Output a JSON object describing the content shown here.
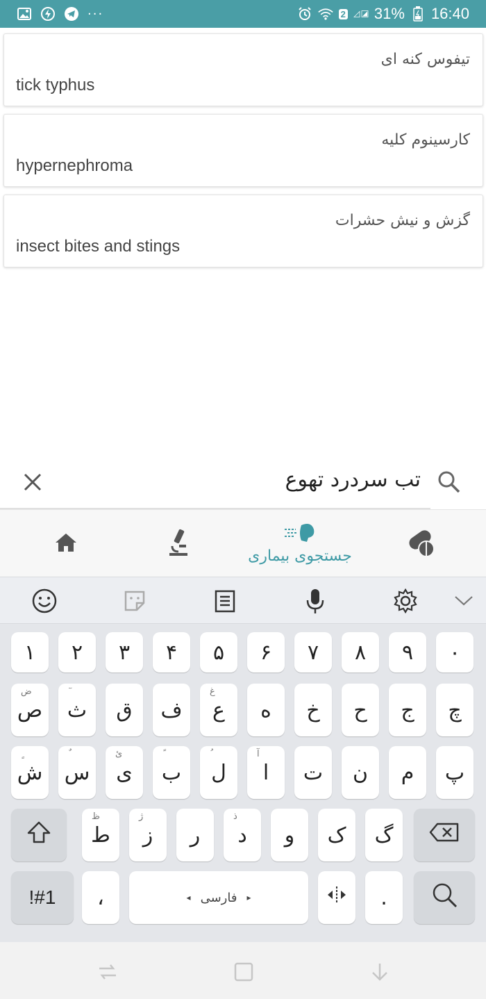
{
  "status_bar": {
    "sim_badge": "2",
    "battery_percent": "31%",
    "time": "16:40",
    "more_dots": "···",
    "icons": [
      "gallery-icon",
      "power-saving-icon",
      "telegram-icon",
      "alarm-icon",
      "wifi-icon",
      "signal-icon",
      "battery-icon"
    ]
  },
  "results": [
    {
      "persian": "تیفوس کنه ای",
      "english": "tick typhus"
    },
    {
      "persian": "کارسینوم کلیه",
      "english": "hypernephroma"
    },
    {
      "persian": "گزش و نیش حشرات",
      "english": "insect bites and stings"
    }
  ],
  "search": {
    "value": "تب سردرد تهوع"
  },
  "tabs": [
    {
      "name": "home",
      "icon": "home-icon",
      "label": ""
    },
    {
      "name": "lab",
      "icon": "microscope-icon",
      "label": ""
    },
    {
      "name": "disease-search",
      "icon": "sneeze-icon",
      "label": "جستجوی بیماری",
      "active": true
    },
    {
      "name": "drugs",
      "icon": "pills-icon",
      "label": ""
    }
  ],
  "keyboard_toolbar": [
    "emoji-icon",
    "sticker-icon",
    "clipboard-icon",
    "mic-icon",
    "gear-icon",
    "chevron-down-icon"
  ],
  "keyboard": {
    "row1": [
      "۱",
      "۲",
      "۳",
      "۴",
      "۵",
      "۶",
      "۷",
      "۸",
      "۹",
      "۰"
    ],
    "row2": [
      {
        "k": "ص",
        "h": "ض"
      },
      {
        "k": "ث",
        "h": "ٓ"
      },
      {
        "k": "ق",
        "h": ""
      },
      {
        "k": "ف",
        "h": ""
      },
      {
        "k": "ع",
        "h": "غ"
      },
      {
        "k": "ه",
        "h": ""
      },
      {
        "k": "خ",
        "h": ""
      },
      {
        "k": "ح",
        "h": ""
      },
      {
        "k": "ج",
        "h": ""
      },
      {
        "k": "چ",
        "h": ""
      }
    ],
    "row3": [
      {
        "k": "ش",
        "h": "ٍ"
      },
      {
        "k": "س",
        "h": "ٌ"
      },
      {
        "k": "ی",
        "h": "ئ"
      },
      {
        "k": "ب",
        "h": "ً"
      },
      {
        "k": "ل",
        "h": "ُ"
      },
      {
        "k": "ا",
        "h": "آ"
      },
      {
        "k": "ت",
        "h": ""
      },
      {
        "k": "ن",
        "h": ""
      },
      {
        "k": "م",
        "h": ""
      },
      {
        "k": "پ",
        "h": ""
      }
    ],
    "row4": [
      {
        "k": "ط",
        "h": "ظ"
      },
      {
        "k": "ز",
        "h": "ژ"
      },
      {
        "k": "ر",
        "h": ""
      },
      {
        "k": "د",
        "h": "ذ"
      },
      {
        "k": "و",
        "h": ""
      },
      {
        "k": "ک",
        "h": ""
      },
      {
        "k": "گ",
        "h": ""
      }
    ],
    "symbols_label": "!#1",
    "comma_label": "،",
    "space_label": "فارسی",
    "period_label": "."
  },
  "colors": {
    "accent": "#4a9ea6",
    "tab_label": "#3e9aa5"
  }
}
